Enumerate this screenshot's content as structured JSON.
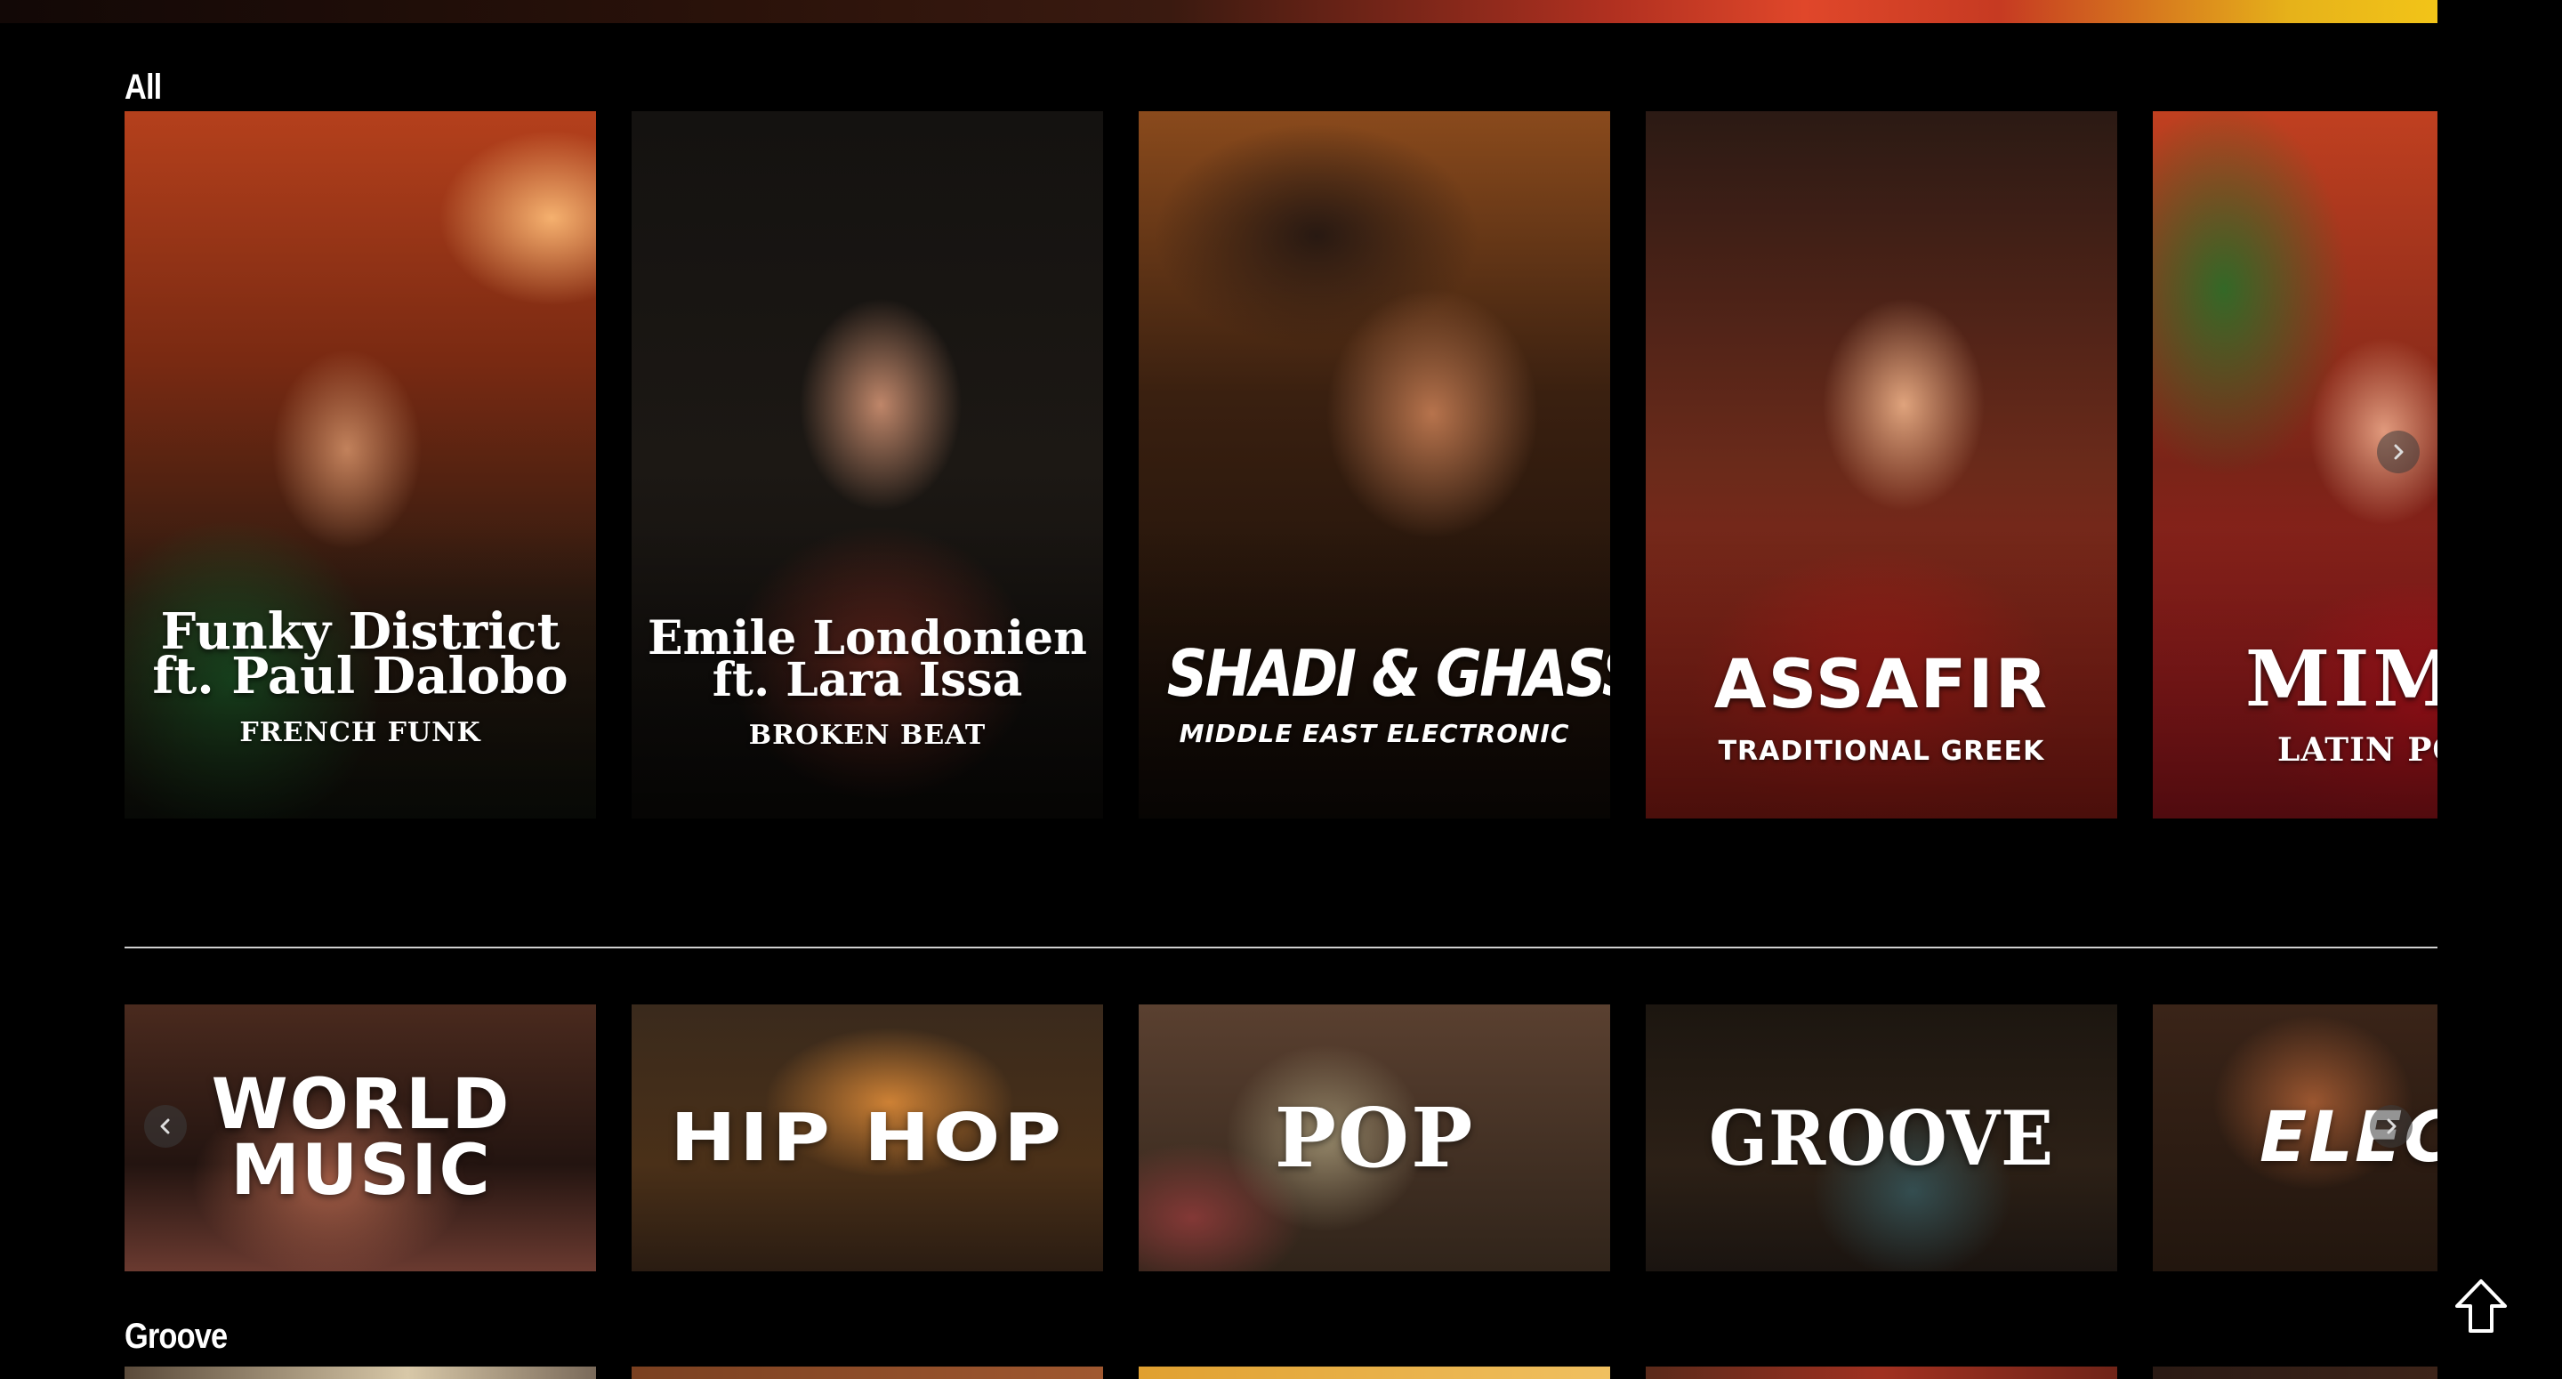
{
  "sections": {
    "all_title": "All",
    "groove_title": "Groove"
  },
  "artist_cards": [
    {
      "name_line1": "Funky District",
      "name_line2": "ft. Paul Dalobo",
      "genre": "FRENCH FUNK"
    },
    {
      "name_line1": "Emile Londonien",
      "name_line2": "ft. Lara Issa",
      "genre": "BROKEN BEAT"
    },
    {
      "name_line1": "SHADI & GHASSAN",
      "name_line2": "",
      "genre": "MIDDLE EAST ELECTRONIC"
    },
    {
      "name_line1": "ASSAFIR",
      "name_line2": "",
      "genre": "TRADITIONAL GREEK"
    },
    {
      "name_line1": "MIMA",
      "name_line2": "",
      "genre": "LATIN PO"
    }
  ],
  "genre_tiles": [
    {
      "label": "WORLD MUSIC"
    },
    {
      "label": "HIP HOP"
    },
    {
      "label": "POP"
    },
    {
      "label": "GROOVE"
    },
    {
      "label": "ELECT"
    }
  ],
  "icons": {
    "carousel_next": "chevron-right-icon",
    "carousel_prev": "chevron-left-icon",
    "scroll_top": "arrow-up-icon"
  },
  "colors": {
    "background": "#000000",
    "text": "#ffffff",
    "divider": "#cfcfcf"
  }
}
